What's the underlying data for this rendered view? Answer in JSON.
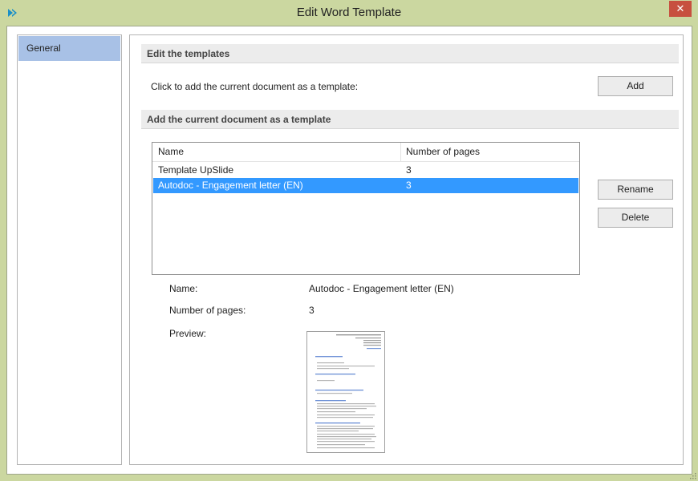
{
  "window": {
    "title": "Edit Word Template",
    "close_glyph": "✕"
  },
  "sidebar": {
    "items": [
      {
        "label": "General",
        "selected": true
      }
    ]
  },
  "main": {
    "section_edit": "Edit the templates",
    "add_prompt": "Click to add the current document as a template:",
    "add_button": "Add",
    "section_add": "Add the current document as a template",
    "list": {
      "columns": [
        "Name",
        "Number of pages"
      ],
      "rows": [
        {
          "name": "Template UpSlide",
          "pages": "3",
          "selected": false
        },
        {
          "name": "Autodoc - Engagement letter (EN)",
          "pages": "3",
          "selected": true
        }
      ]
    },
    "rename_button": "Rename",
    "delete_button": "Delete",
    "details": {
      "name_label": "Name:",
      "name_value": "Autodoc - Engagement letter (EN)",
      "pages_label": "Number of pages:",
      "pages_value": "3",
      "preview_label": "Preview:"
    }
  },
  "icons": {
    "app": "upslide-chevrons-icon",
    "close": "close-icon",
    "resize": "resize-grip-icon"
  },
  "colors": {
    "frame": "#cbd7a0",
    "selection": "#3399ff",
    "sidebar_selected": "#a8c1e6",
    "close": "#c7503f",
    "section_header": "#ececec"
  }
}
